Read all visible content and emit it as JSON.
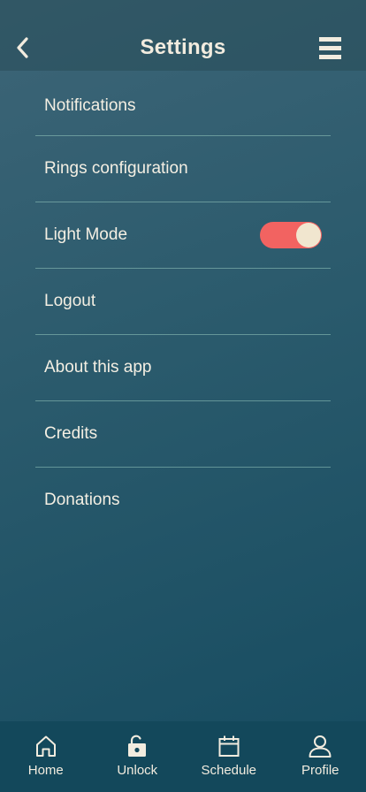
{
  "header": {
    "title": "Settings",
    "back_icon": "chevron-left-icon",
    "menu_icon": "hamburger-menu-icon"
  },
  "settings": {
    "items": [
      {
        "label": "Notifications"
      },
      {
        "label": "Rings configuration"
      },
      {
        "label": "Light Mode",
        "toggle": true,
        "toggle_on": true
      },
      {
        "label": "Logout"
      },
      {
        "label": "About this app"
      },
      {
        "label": "Credits"
      },
      {
        "label": "Donations"
      }
    ]
  },
  "tabbar": {
    "tabs": [
      {
        "label": "Home",
        "icon": "home-icon"
      },
      {
        "label": "Unlock",
        "icon": "unlock-icon"
      },
      {
        "label": "Schedule",
        "icon": "calendar-icon"
      },
      {
        "label": "Profile",
        "icon": "user-icon"
      }
    ]
  },
  "colors": {
    "text": "#f2ecdf",
    "toggle_track": "#f26361",
    "toggle_knob": "#f1e6cf",
    "tabbar_bg": "#13485b",
    "divider": "#96c8be"
  }
}
